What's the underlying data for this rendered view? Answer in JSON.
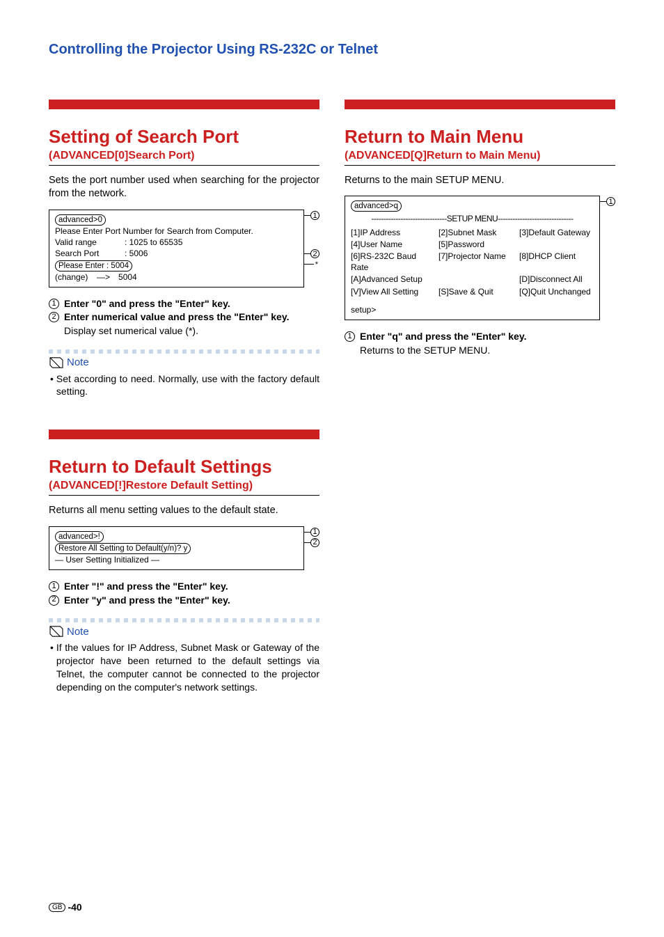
{
  "page_title": "Controlling the Projector Using RS-232C or Telnet",
  "sections": {
    "search_port": {
      "heading": "Setting of Search Port",
      "subheading": "(ADVANCED[0]Search Port)",
      "body": "Sets the port number used when searching for the projector from the network.",
      "terminal": {
        "chip1": "advanced>0",
        "line1": "Please Enter Port Number for Search from Computer.",
        "line2a": "Valid range",
        "line2b": ": 1025 to 65535",
        "line3a": "Search Port",
        "line3b": ": 5006",
        "chip2": "Please Enter         : 5004",
        "line5a": "(change)",
        "line5b": "5004"
      },
      "callout1": "1",
      "callout2": "2",
      "asterisk": "*",
      "instructions": [
        {
          "num": "1",
          "bold": "Enter \"0\" and press the \"Enter\" key.",
          "rest": ""
        },
        {
          "num": "2",
          "bold": "Enter numerical value and press the \"Enter\" key.",
          "rest": "Display set numerical value (*)."
        }
      ],
      "note_label": "Note",
      "note_text": "Set according to need. Normally, use with the factory default setting."
    },
    "default_settings": {
      "heading": "Return to Default Settings",
      "subheading": "(ADVANCED[!]Restore Default Setting)",
      "body": "Returns all menu setting values to the default state.",
      "terminal": {
        "chip1": "advanced>!",
        "chip2": "Restore All Setting to Default(y/n)? y",
        "line3": "— User Setting Initialized —"
      },
      "callout1": "1",
      "callout2": "2",
      "instructions": [
        {
          "num": "1",
          "bold": "Enter \"!\" and press the \"Enter\" key.",
          "rest": ""
        },
        {
          "num": "2",
          "bold": "Enter \"y\" and press the \"Enter\" key.",
          "rest": ""
        }
      ],
      "note_label": "Note",
      "note_text": "If the values for IP Address, Subnet Mask or Gateway of the projector have been returned to the default settings via Telnet, the computer cannot be connected to the projector depending on the computer's network settings."
    },
    "main_menu": {
      "heading": "Return to Main Menu",
      "subheading": "(ADVANCED[Q]Return to Main Menu)",
      "body": "Returns to the main SETUP MENU.",
      "terminal": {
        "chip1": "advanced>q",
        "menu_title": "-------------------------------SETUP MENU-------------------------------",
        "r1c1": "[1]IP Address",
        "r1c2": "[2]Subnet Mask",
        "r1c3": "[3]Default Gateway",
        "r2c1": "[4]User Name",
        "r2c2": "[5]Password",
        "r2c3": "",
        "r3c1": "[6]RS-232C Baud Rate",
        "r3c2": "[7]Projector Name",
        "r3c3": "[8]DHCP Client",
        "r4c1": "[A]Advanced Setup",
        "r4c2": "",
        "r4c3": "[D]Disconnect All",
        "r5c1": "[V]View All Setting",
        "r5c2": "[S]Save & Quit",
        "r5c3": "[Q]Quit Unchanged",
        "prompt": "setup>"
      },
      "callout1": "1",
      "instructions": [
        {
          "num": "1",
          "bold": "Enter \"q\" and press the \"Enter\" key.",
          "rest": "Returns to the SETUP MENU."
        }
      ]
    }
  },
  "footer": {
    "gb": "GB",
    "page": "-40"
  }
}
